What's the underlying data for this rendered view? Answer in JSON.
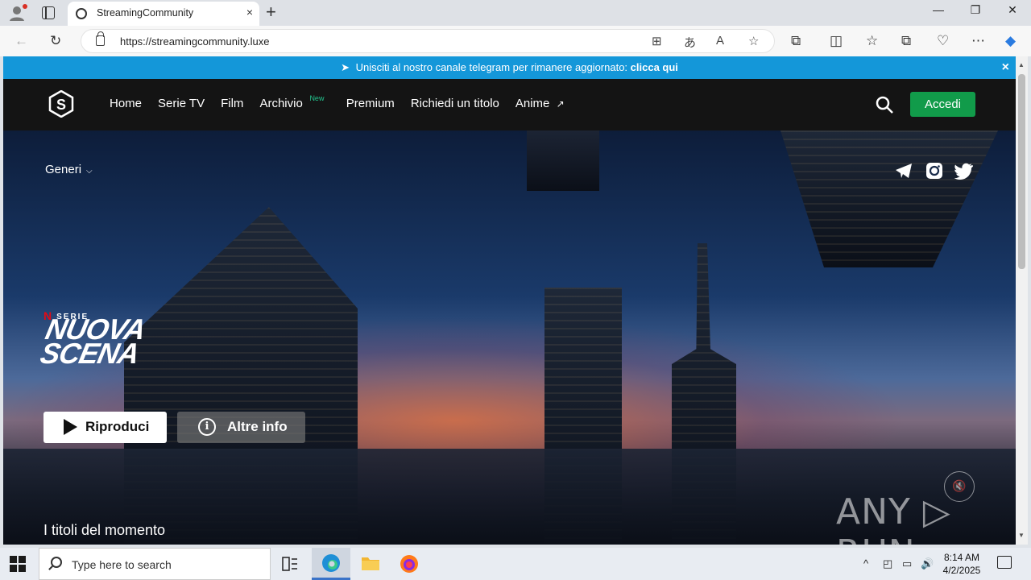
{
  "browser": {
    "tab_title": "StreamingCommunity",
    "url": "https://streamingcommunity.luxe",
    "new_tab": "+",
    "close_tab": "×",
    "window": {
      "minimize": "—",
      "restore": "❐",
      "close": "✕"
    }
  },
  "banner": {
    "text": "Unisciti al nostro canale telegram per rimanere aggiornato:",
    "link": "clicca qui",
    "close": "×"
  },
  "nav": {
    "items": [
      "Home",
      "Serie TV",
      "Film",
      "Archivio",
      "Premium",
      "Richiedi un titolo",
      "Anime"
    ],
    "archivio_badge": "New",
    "anime_arrow": "↗",
    "login": "Accedi"
  },
  "hero": {
    "genres": "Generi",
    "genres_chevron": "⌵",
    "badge_n": "N",
    "badge_text": "SERIE",
    "show_title_line1": "NUOVA",
    "show_title_line2": "SCENA",
    "play": "Riproduci",
    "info_icon": "i",
    "info": "Altre info",
    "mute_icon": "🔇",
    "trending": "I titoli del momento"
  },
  "watermark": "ANY ▷ RUN",
  "taskbar": {
    "search_placeholder": "Type here to search",
    "time": "8:14 AM",
    "date": "4/2/2025",
    "tray_up": "^"
  },
  "colors": {
    "banner": "#1497d9",
    "login_button": "#119b4a",
    "new_badge": "#23c48e",
    "netflix_red": "#e50914"
  }
}
